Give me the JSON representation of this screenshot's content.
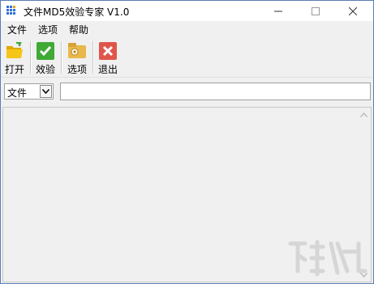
{
  "window": {
    "title": "文件MD5效验专家 V1.0"
  },
  "menu": {
    "items": [
      {
        "label": "文件"
      },
      {
        "label": "选项"
      },
      {
        "label": "帮助"
      }
    ]
  },
  "toolbar": {
    "open_label": "打开",
    "verify_label": "效验",
    "options_label": "选项",
    "exit_label": "退出"
  },
  "source_select": {
    "value": "文件"
  },
  "path_input": {
    "value": ""
  },
  "colors": {
    "title_bar": "#ffffff",
    "window_bg": "#f0f0f0",
    "open_icon": "#f5c518",
    "verify_icon": "#3faa35",
    "options_icon": "#e8b84a",
    "exit_icon": "#e0554a"
  }
}
